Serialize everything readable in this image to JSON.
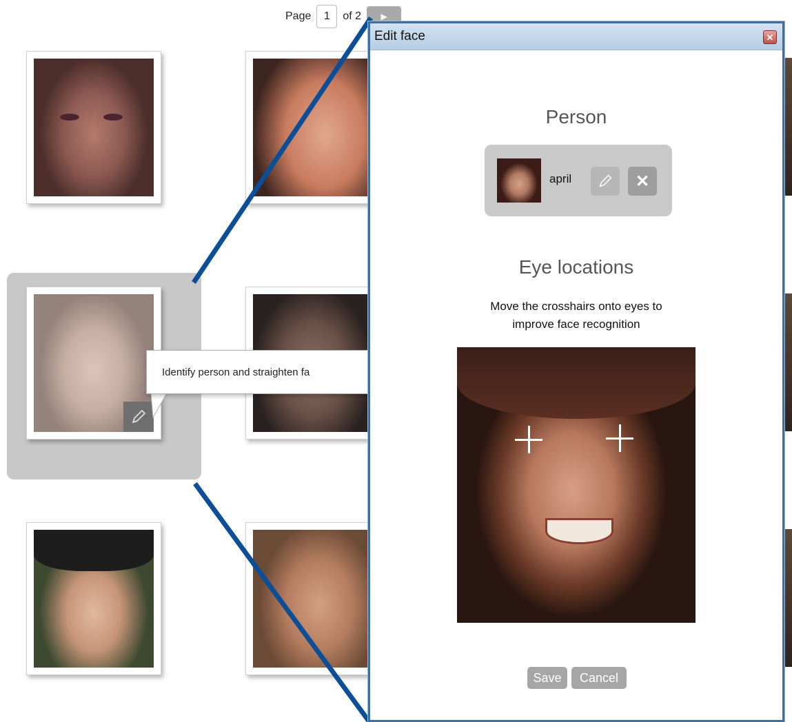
{
  "pager": {
    "label": "Page",
    "current": "1",
    "of_text": "of 2",
    "next_icon": "play-icon"
  },
  "tooltip": {
    "text": "Identify person and straighten fa"
  },
  "dialog": {
    "title": "Edit face",
    "close_icon": "close-icon",
    "person_section_title": "Person",
    "person": {
      "name": "april",
      "edit_icon": "pencil-icon",
      "remove_icon": "close-icon"
    },
    "eye_section_title": "Eye locations",
    "instructions_line1": "Move the crosshairs onto eyes to",
    "instructions_line2": "improve face recognition",
    "save_label": "Save",
    "cancel_label": "Cancel"
  },
  "colors": {
    "dialog_border": "#3d6fa0",
    "callout_line": "#0d4f96",
    "button_gray": "#a6a6a6"
  }
}
